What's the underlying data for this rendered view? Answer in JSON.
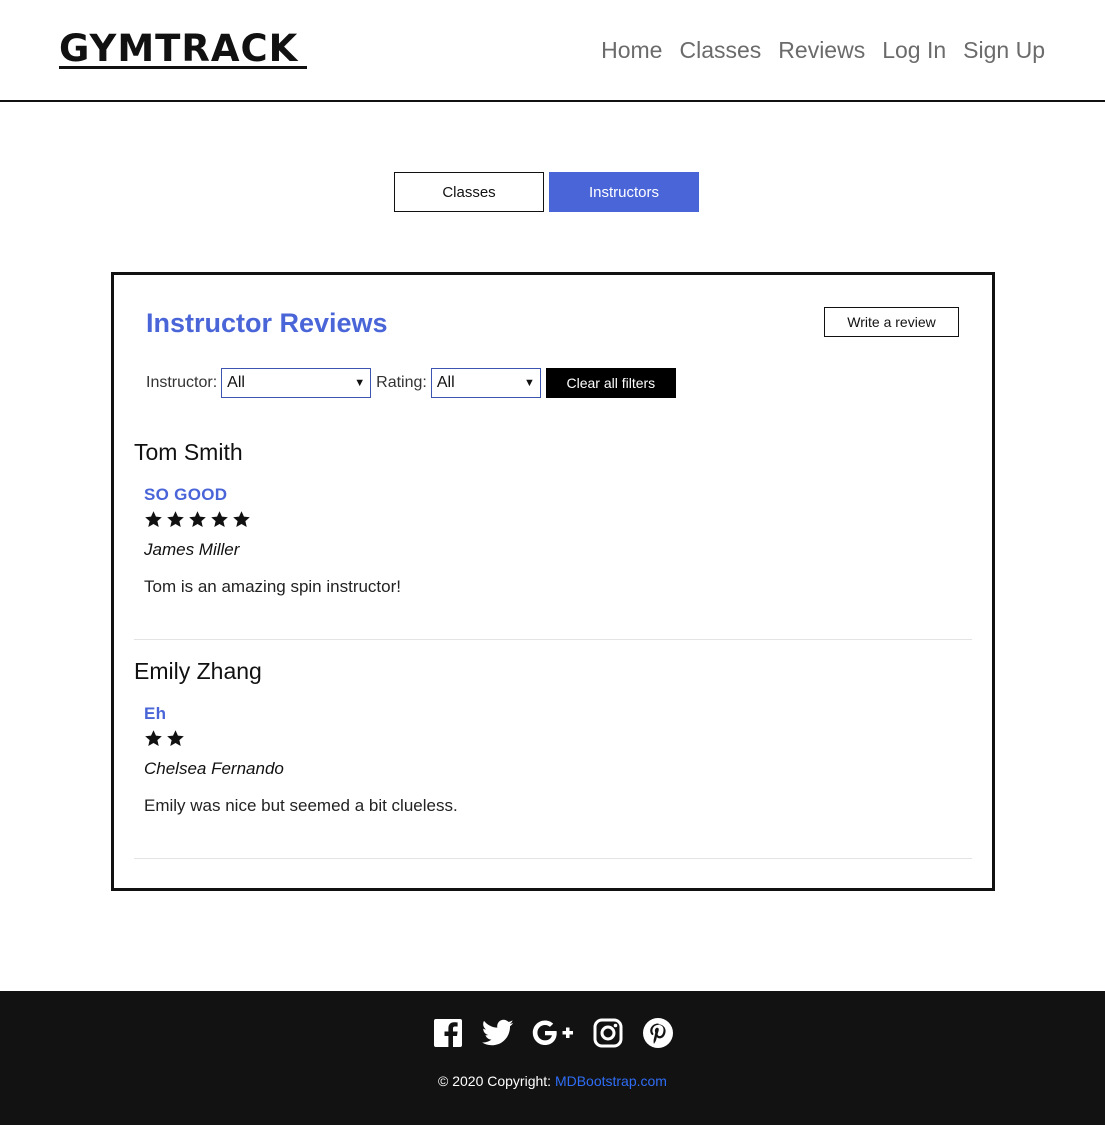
{
  "brand": {
    "logo_text": "GYMTRACK"
  },
  "nav": {
    "items": [
      {
        "label": "Home"
      },
      {
        "label": "Classes"
      },
      {
        "label": "Reviews"
      },
      {
        "label": "Log In"
      },
      {
        "label": "Sign Up"
      }
    ]
  },
  "toggle": {
    "classes_label": "Classes",
    "instructors_label": "Instructors",
    "active": "Instructors"
  },
  "card": {
    "title": "Instructor Reviews",
    "write_review_label": "Write a review",
    "filters": {
      "instructor_label": "Instructor:",
      "instructor_value": "All",
      "rating_label": "Rating:",
      "rating_value": "All",
      "clear_label": "Clear all filters"
    }
  },
  "reviews": [
    {
      "instructor": "Tom Smith",
      "headline": "SO GOOD",
      "rating": 5,
      "author": "James Miller",
      "body": "Tom is an amazing spin instructor!"
    },
    {
      "instructor": "Emily Zhang",
      "headline": "Eh",
      "rating": 2,
      "author": "Chelsea Fernando",
      "body": "Emily was nice but seemed a bit clueless."
    }
  ],
  "footer": {
    "social_icons": [
      "facebook-icon",
      "twitter-icon",
      "google-plus-icon",
      "instagram-icon",
      "pinterest-icon"
    ],
    "copyright_prefix": "© 2020 Copyright: ",
    "copyright_link": "MDBootstrap.com"
  },
  "colors": {
    "accent": "#4a65d8",
    "link": "#2f6df5",
    "footer_bg": "#121212",
    "nav_text": "#6b6b6b"
  }
}
